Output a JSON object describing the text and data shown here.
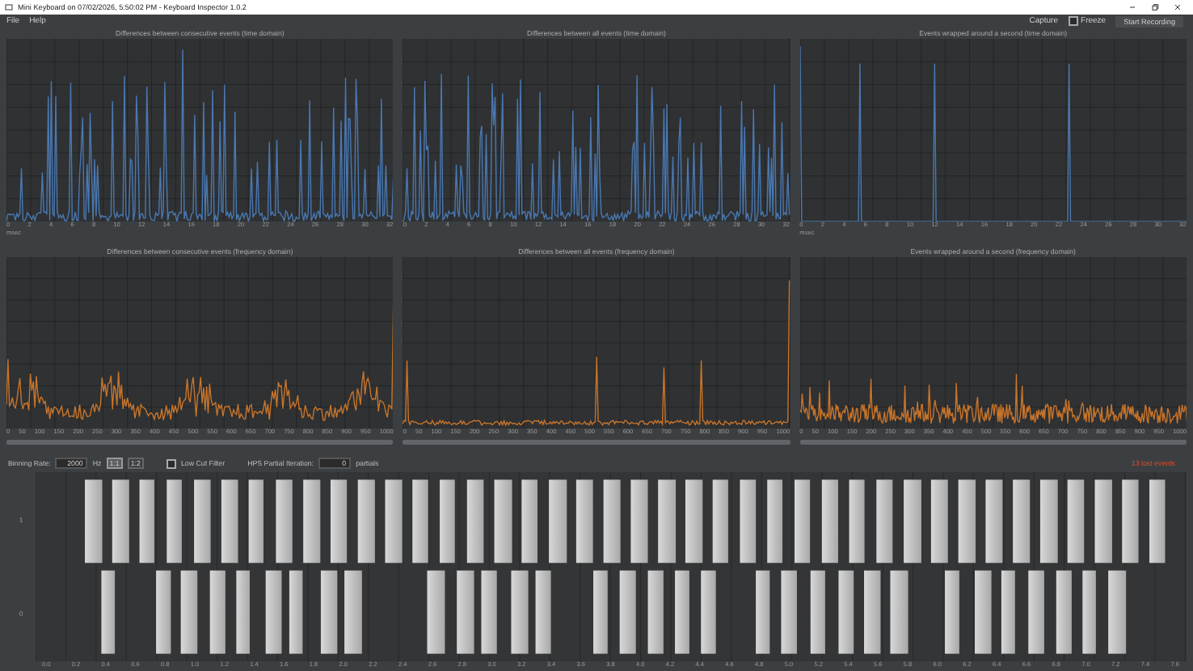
{
  "window": {
    "title": "Mini Keyboard on 07/02/2026, 5:50:02 PM - Keyboard Inspector 1.0.2"
  },
  "menu": [
    "File",
    "Help"
  ],
  "toolbar": {
    "capture": "Capture",
    "freeze": {
      "label": "Freeze",
      "checked": false
    },
    "record_button": "Start Recording"
  },
  "charts": [
    {
      "title": "Differences between consecutive events (time domain)",
      "color": "#4a78b0",
      "kind": "spiky",
      "unit": "msec",
      "xticks": [
        "0",
        "2",
        "4",
        "6",
        "8",
        "10",
        "12",
        "14",
        "16",
        "18",
        "20",
        "22",
        "24",
        "26",
        "28",
        "30",
        "32"
      ]
    },
    {
      "title": "Differences between all events (time domain)",
      "color": "#4a78b0",
      "kind": "spiky",
      "xticks": [
        "0",
        "2",
        "4",
        "6",
        "8",
        "10",
        "12",
        "14",
        "16",
        "18",
        "20",
        "22",
        "24",
        "26",
        "28",
        "30",
        "32"
      ]
    },
    {
      "title": "Events wrapped around a second (time domain)",
      "color": "#4a78b0",
      "kind": "sparse",
      "unit": "msec",
      "xticks": [
        "0",
        "2",
        "4",
        "6",
        "8",
        "10",
        "12",
        "14",
        "16",
        "18",
        "20",
        "22",
        "24",
        "26",
        "28",
        "30",
        "32"
      ]
    },
    {
      "title": "Differences between consecutive events (frequency domain)",
      "color": "#c8742a",
      "kind": "bumpy",
      "xticks": [
        "0",
        "50",
        "100",
        "150",
        "200",
        "250",
        "300",
        "350",
        "400",
        "450",
        "500",
        "550",
        "600",
        "650",
        "700",
        "750",
        "800",
        "850",
        "900",
        "950",
        "1000"
      ]
    },
    {
      "title": "Differences between all events (frequency domain)",
      "color": "#c8742a",
      "kind": "flat",
      "xticks": [
        "0",
        "50",
        "100",
        "150",
        "200",
        "250",
        "300",
        "350",
        "400",
        "450",
        "500",
        "550",
        "600",
        "650",
        "700",
        "750",
        "800",
        "850",
        "900",
        "950",
        "1000"
      ]
    },
    {
      "title": "Events wrapped around a second (frequency domain)",
      "color": "#c8742a",
      "kind": "noisy",
      "xticks": [
        "0",
        "50",
        "100",
        "150",
        "200",
        "250",
        "300",
        "350",
        "400",
        "450",
        "500",
        "550",
        "600",
        "650",
        "700",
        "750",
        "800",
        "850",
        "900",
        "950",
        "1000"
      ]
    }
  ],
  "controls": {
    "binning_label": "Binning Rate:",
    "binning_value": "2000",
    "binning_unit": "Hz",
    "ratio_buttons": [
      {
        "label": "1:1",
        "selected": true
      },
      {
        "label": "1:2",
        "selected": false
      }
    ],
    "low_cut": {
      "label": "Low Cut Filter",
      "checked": false
    },
    "hps_label": "HPS Partial Iteration:",
    "hps_value": "0",
    "hps_unit": "partials",
    "status": "13 lost events"
  },
  "timeline": {
    "row_labels": [
      "1",
      "0"
    ],
    "xticks": [
      "0.0",
      "0.2",
      "0.4",
      "0.6",
      "0.8",
      "1.0",
      "1.2",
      "1.4",
      "1.6",
      "1.8",
      "2.0",
      "2.2",
      "2.4",
      "2.6",
      "2.8",
      "3.0",
      "3.2",
      "3.4",
      "3.6",
      "3.8",
      "4.0",
      "4.2",
      "4.4",
      "4.6",
      "4.8",
      "5.0",
      "5.2",
      "5.4",
      "5.6",
      "5.8",
      "6.0",
      "6.2",
      "6.4",
      "6.6",
      "6.8",
      "7.0",
      "7.2",
      "7.4",
      "7.6"
    ]
  }
}
